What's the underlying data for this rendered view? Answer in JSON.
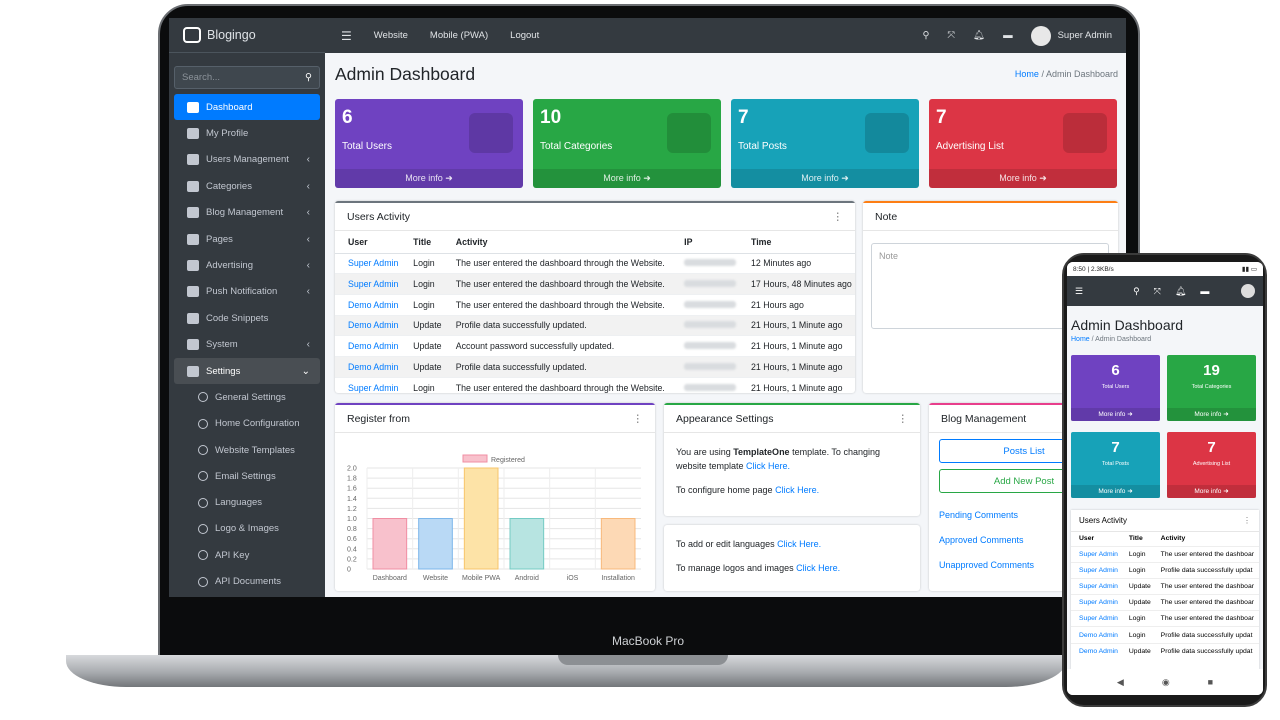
{
  "device": {
    "laptop_label": "MacBook Pro"
  },
  "brand": "Blogingo",
  "search_placeholder": "Search...",
  "sidebar": [
    {
      "label": "Dashboard",
      "icon": "dashboard-icon",
      "active": true
    },
    {
      "label": "My Profile",
      "icon": "user-icon"
    },
    {
      "label": "Users Management",
      "icon": "users-icon",
      "arrow": "‹"
    },
    {
      "label": "Categories",
      "icon": "list-icon",
      "arrow": "‹"
    },
    {
      "label": "Blog Management",
      "icon": "blog-icon",
      "arrow": "‹"
    },
    {
      "label": "Pages",
      "icon": "page-icon",
      "arrow": "‹"
    },
    {
      "label": "Advertising",
      "icon": "ad-icon",
      "arrow": "‹"
    },
    {
      "label": "Push Notification",
      "icon": "send-icon",
      "arrow": "‹"
    },
    {
      "label": "Code Snippets",
      "icon": "code-icon"
    },
    {
      "label": "System",
      "icon": "gear-icon",
      "arrow": "‹"
    },
    {
      "label": "Settings",
      "icon": "tools-icon",
      "arrow": "⌄",
      "open": true
    }
  ],
  "submenu": [
    "General Settings",
    "Home Configuration",
    "Website Templates",
    "Email Settings",
    "Languages",
    "Logo & Images",
    "API Key",
    "API Documents"
  ],
  "topnav": {
    "links": [
      "Website",
      "Mobile (PWA)",
      "Logout"
    ],
    "user": "Super Admin"
  },
  "page": {
    "title": "Admin Dashboard",
    "breadcrumb_home": "Home",
    "breadcrumb_current": "Admin Dashboard"
  },
  "stats": [
    {
      "num": "6",
      "label": "Total Users",
      "more": "More info ➜",
      "color": "#6f42c1"
    },
    {
      "num": "10",
      "label": "Total Categories",
      "more": "More info ➜",
      "color": "#28a745"
    },
    {
      "num": "7",
      "label": "Total Posts",
      "more": "More info ➜",
      "color": "#17a2b8"
    },
    {
      "num": "7",
      "label": "Advertising List",
      "more": "More info ➜",
      "color": "#dc3545"
    }
  ],
  "activity": {
    "title": "Users Activity",
    "headers": [
      "User",
      "Title",
      "Activity",
      "IP",
      "Time"
    ],
    "rows": [
      [
        "Super Admin",
        "Login",
        "The user entered the dashboard through the Website.",
        "12 Minutes ago"
      ],
      [
        "Super Admin",
        "Login",
        "The user entered the dashboard through the Website.",
        "17 Hours, 48 Minutes ago"
      ],
      [
        "Demo Admin",
        "Login",
        "The user entered the dashboard through the Website.",
        "21 Hours ago"
      ],
      [
        "Demo Admin",
        "Update",
        "Profile data successfully updated.",
        "21 Hours, 1 Minute ago"
      ],
      [
        "Demo Admin",
        "Update",
        "Account password successfully updated.",
        "21 Hours, 1 Minute ago"
      ],
      [
        "Demo Admin",
        "Update",
        "Profile data successfully updated.",
        "21 Hours, 1 Minute ago"
      ],
      [
        "Super Admin",
        "Login",
        "The user entered the dashboard through the Website.",
        "21 Hours, 1 Minute ago"
      ]
    ]
  },
  "note": {
    "title": "Note",
    "placeholder": "Note"
  },
  "register": {
    "title": "Register from"
  },
  "chart_data": {
    "type": "bar",
    "categories": [
      "Dashboard",
      "Website",
      "Mobile PWA",
      "Android",
      "iOS",
      "Installation"
    ],
    "series": [
      {
        "name": "Registered",
        "values": [
          1,
          1,
          2,
          1,
          0,
          1
        ]
      }
    ],
    "ylim": [
      0,
      2
    ],
    "yticks": [
      "2.0",
      "1.8",
      "1.6",
      "1.4",
      "1.2",
      "1.0",
      "0.8",
      "0.6",
      "0.4",
      "0.2",
      "0"
    ],
    "colors": [
      "#f8c1cc",
      "#b9d9f5",
      "#fde3a7",
      "#b7e4e1",
      "#e1e1e1",
      "#fdd9b5"
    ],
    "borders": [
      "#f08ea3",
      "#7cb6ea",
      "#f7c56b",
      "#74cbc4",
      "#bbbbbb",
      "#f8b97c"
    ],
    "grid": true,
    "legend": "top"
  },
  "appearance": {
    "title": "Appearance Settings",
    "l1a": "You are using ",
    "l1b": "TemplateOne",
    "l1c": " template. To changing website template ",
    "l1link": "Click Here.",
    "l2a": "To configure home page ",
    "l2link": "Click Here.",
    "l3a": "To add or edit languages ",
    "l3link": "Click Here.",
    "l4a": "To manage logos and images ",
    "l4link": "Click Here."
  },
  "blogmgmt": {
    "title": "Blog Management",
    "posts": "Posts List",
    "add": "Add New Post",
    "links": [
      "Pending Comments",
      "Approved Comments",
      "Unapproved Comments"
    ]
  },
  "phone": {
    "status_left": "8:50 | 2.3KB/s",
    "title": "Admin Dashboard",
    "bc_home": "Home",
    "bc_current": "Admin Dashboard",
    "stats": [
      {
        "num": "6",
        "label": "Total Users",
        "more": "More info ➜",
        "color": "#6f42c1"
      },
      {
        "num": "19",
        "label": "Total Categories",
        "more": "More info ➜",
        "color": "#28a745"
      },
      {
        "num": "7",
        "label": "Total Posts",
        "more": "More info ➜",
        "color": "#17a2b8"
      },
      {
        "num": "7",
        "label": "Advertising List",
        "more": "More info ➜",
        "color": "#dc3545"
      }
    ],
    "activity_title": "Users Activity",
    "headers": [
      "User",
      "Title",
      "Activity"
    ],
    "rows": [
      [
        "Super Admin",
        "Login",
        "The user entered the dashboar"
      ],
      [
        "Super Admin",
        "Login",
        "Profile data successfully updat"
      ],
      [
        "Super Admin",
        "Update",
        "The user entered the dashboar"
      ],
      [
        "Super Admin",
        "Update",
        "The user entered the dashboar"
      ],
      [
        "Super Admin",
        "Login",
        "The user entered the dashboar"
      ],
      [
        "Demo Admin",
        "Login",
        "Profile data successfully updat"
      ],
      [
        "Demo Admin",
        "Update",
        "Profile data successfully updat"
      ]
    ]
  }
}
